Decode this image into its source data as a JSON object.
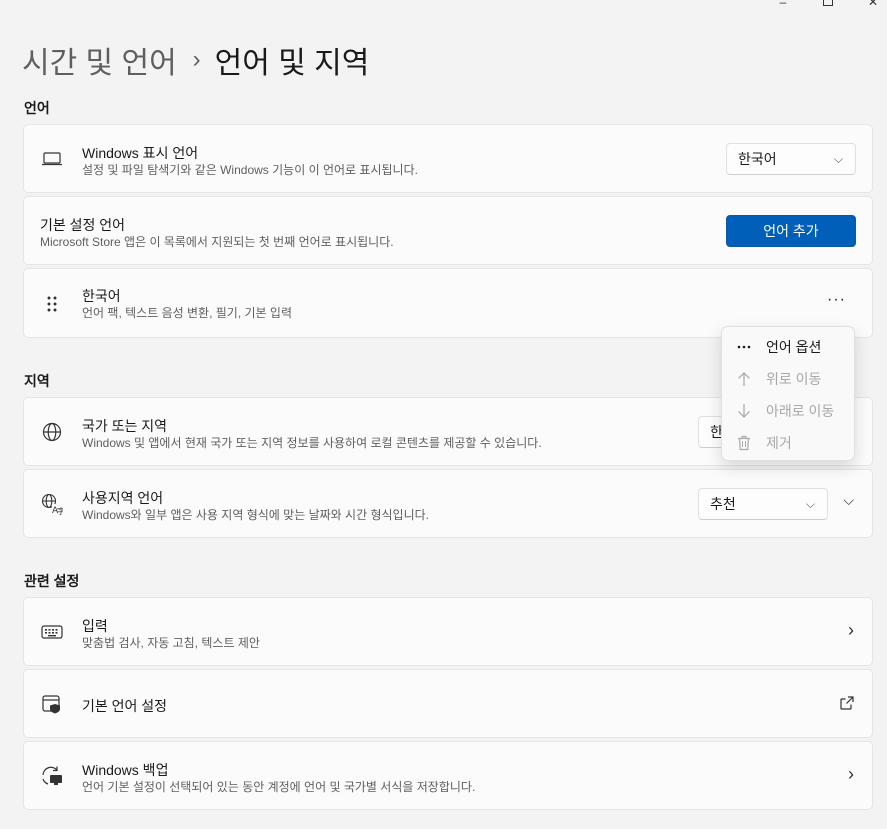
{
  "window": {
    "minimize_glyph": "–",
    "close_glyph": "✕"
  },
  "breadcrumb": {
    "parent": "시간 및 언어",
    "separator": "›",
    "current": "언어 및 지역"
  },
  "sections": {
    "language": "언어",
    "region": "지역",
    "related": "관련 설정"
  },
  "display_language": {
    "icon": "laptop-icon",
    "title": "Windows 표시 언어",
    "description": "설정 및 파일 탐색기와 같은 Windows 기능이 이 언어로 표시됩니다.",
    "selected": "한국어"
  },
  "preferred_language": {
    "title": "기본 설정 언어",
    "description": "Microsoft Store 앱은 이 목록에서 지원되는 첫 번째 언어로 표시됩니다.",
    "add_button": "언어 추가",
    "accent": "#005fb8"
  },
  "language_item": {
    "icon": "drag-handle-icon",
    "title": "한국어",
    "description": "언어 팩, 텍스트 음성 변환, 필기, 기본 입력",
    "more": "···"
  },
  "context_menu": {
    "items": [
      {
        "icon": "more-icon",
        "label": "언어 옵션",
        "enabled": true
      },
      {
        "icon": "arrow-up-icon",
        "label": "위로 이동",
        "enabled": false
      },
      {
        "icon": "arrow-down-icon",
        "label": "아래로 이동",
        "enabled": false
      },
      {
        "icon": "trash-icon",
        "label": "제거",
        "enabled": false
      }
    ]
  },
  "country": {
    "icon": "globe-icon",
    "title": "국가 또는 지역",
    "description": "Windows 및 앱에서 현재 국가 또는 지역 정보를 사용하여 로컬 콘텐츠를 제공할 수 있습니다.",
    "selected_partial": "한"
  },
  "regional_format": {
    "icon": "language-format-icon",
    "title": "사용지역 언어",
    "description": "Windows와 일부 앱은 사용 지역 형식에 맞는 날짜와 시간 형식입니다.",
    "selected": "추천"
  },
  "related": {
    "typing": {
      "icon": "keyboard-icon",
      "title": "입력",
      "description": "맞춤법 검사, 자동 고침, 텍스트 제안"
    },
    "admin_language": {
      "icon": "admin-language-icon",
      "title": "기본 언어 설정"
    },
    "backup": {
      "icon": "backup-icon",
      "title": "Windows 백업",
      "description": "언어 기본 설정이 선택되어 있는 동안 계정에 언어 및 국가별 서식을 저장합니다."
    }
  }
}
